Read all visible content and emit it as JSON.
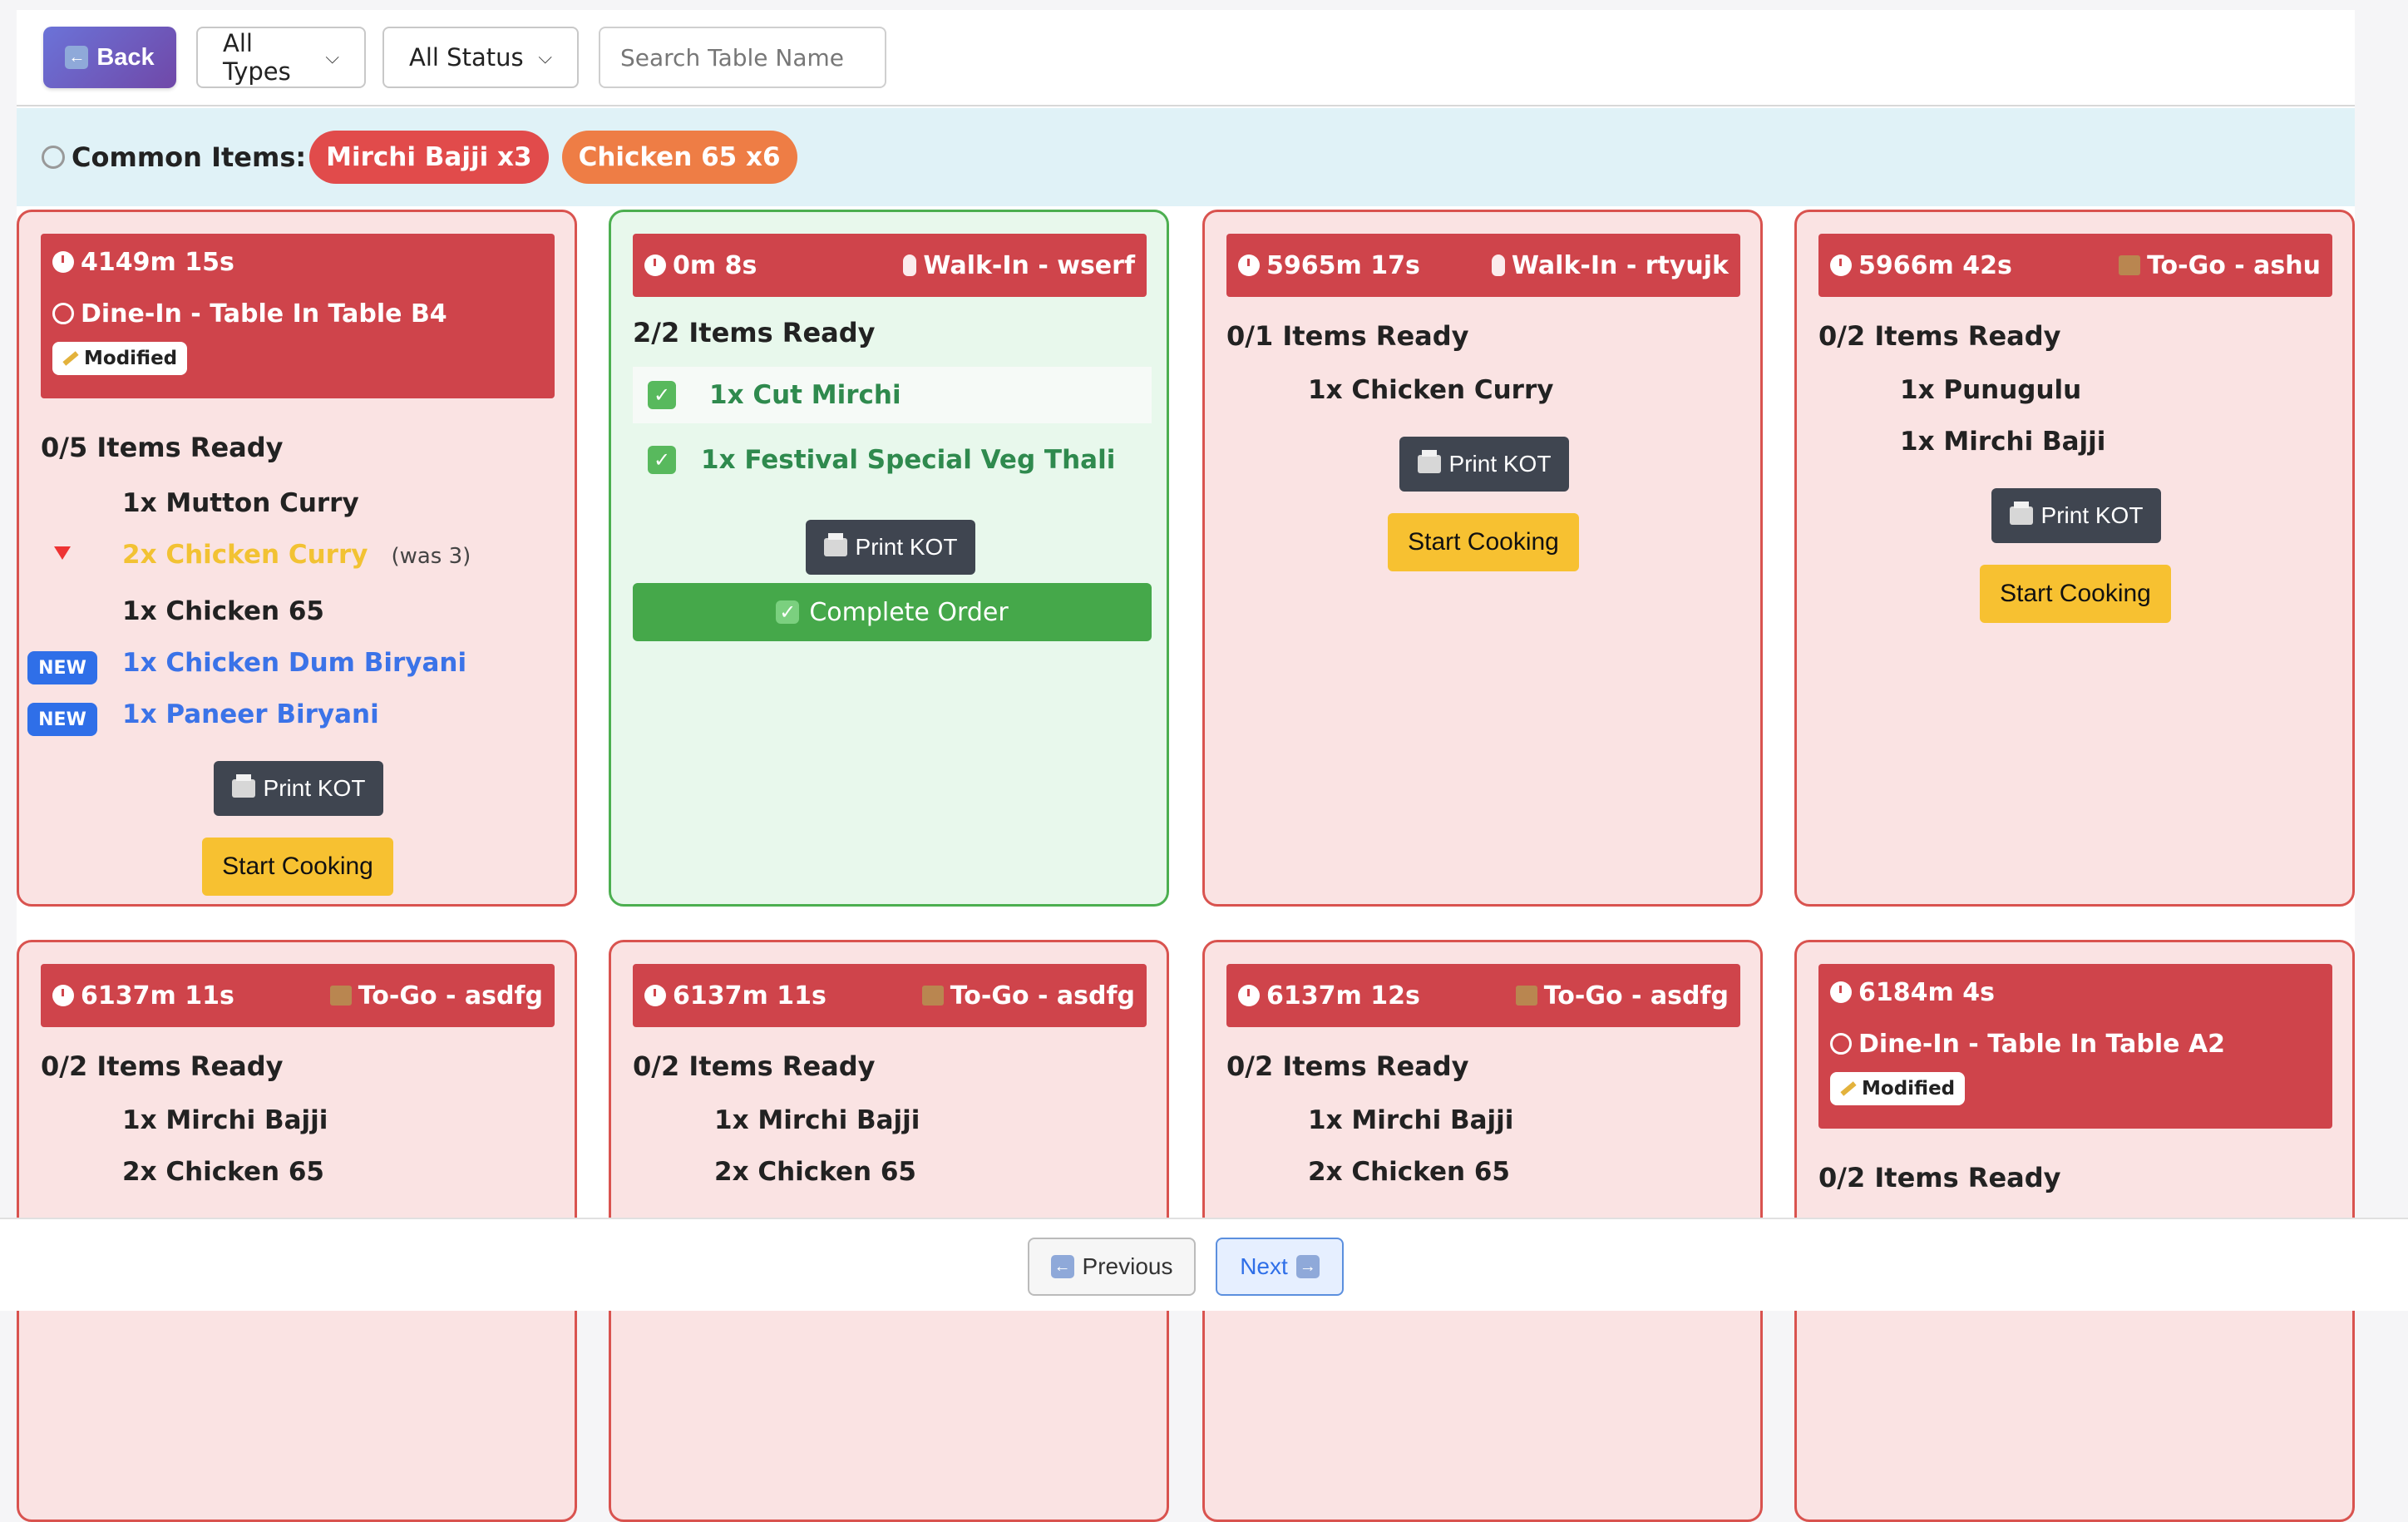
{
  "toolbar": {
    "back_label": "Back",
    "type_filter": "All Types",
    "status_filter": "All Status",
    "search_placeholder": "Search Table Name"
  },
  "common": {
    "label": "Common Items:",
    "chips": [
      {
        "text": "Mirchi Bajji x3",
        "color": "#e14b4b"
      },
      {
        "text": "Chicken 65 x6",
        "color": "#ee7d45"
      }
    ]
  },
  "orders": [
    {
      "timer": "4149m 15s",
      "type_line": "Dine-In - Table In Table B4",
      "modified": "Modified",
      "ready": "0/5 Items Ready",
      "items": [
        {
          "text": "1x Mutton Curry"
        },
        {
          "text": "2x Chicken Curry",
          "was": "(was 3)"
        },
        {
          "text": "1x Chicken 65"
        },
        {
          "text": "1x Chicken Dum Biryani",
          "badge": "NEW"
        },
        {
          "text": "1x Paneer Biryani",
          "badge": "NEW"
        }
      ],
      "print": "Print KOT",
      "action": "Start Cooking"
    },
    {
      "timer": "0m 8s",
      "type_line": "Walk-In - wserf",
      "ready": "2/2 Items Ready",
      "items": [
        {
          "text": "1x Cut Mirchi"
        },
        {
          "text": "1x Festival Special Veg Thali"
        }
      ],
      "print": "Print KOT",
      "action": "Complete Order"
    },
    {
      "timer": "5965m 17s",
      "type_line": "Walk-In - rtyujk",
      "ready": "0/1 Items Ready",
      "items": [
        {
          "text": "1x Chicken Curry"
        }
      ],
      "print": "Print KOT",
      "action": "Start Cooking"
    },
    {
      "timer": "5966m 42s",
      "type_line": "To-Go - ashu",
      "ready": "0/2 Items Ready",
      "items": [
        {
          "text": "1x Punugulu"
        },
        {
          "text": "1x Mirchi Bajji"
        }
      ],
      "print": "Print KOT",
      "action": "Start Cooking"
    },
    {
      "timer": "6137m 11s",
      "type_line": "To-Go - asdfg",
      "ready": "0/2 Items Ready",
      "items": [
        {
          "text": "1x Mirchi Bajji"
        },
        {
          "text": "2x Chicken 65"
        }
      ]
    },
    {
      "timer": "6137m 11s",
      "type_line": "To-Go - asdfg",
      "ready": "0/2 Items Ready",
      "items": [
        {
          "text": "1x Mirchi Bajji"
        },
        {
          "text": "2x Chicken 65"
        }
      ]
    },
    {
      "timer": "6137m 12s",
      "type_line": "To-Go - asdfg",
      "ready": "0/2 Items Ready",
      "items": [
        {
          "text": "1x Mirchi Bajji"
        },
        {
          "text": "2x Chicken 65"
        }
      ]
    },
    {
      "timer": "6184m 4s",
      "type_line": "Dine-In - Table In Table A2",
      "modified": "Modified",
      "ready": "0/2 Items Ready"
    }
  ],
  "pagination": {
    "previous": "Previous",
    "next": "Next"
  }
}
